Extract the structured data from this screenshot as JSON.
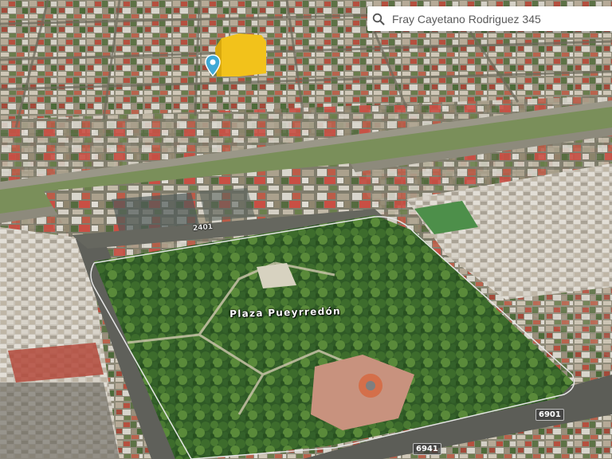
{
  "search": {
    "value": "Fray Cayetano Rodriguez 345",
    "icon": "search-icon"
  },
  "map": {
    "type": "3d-satellite",
    "place_label": "Plaza Pueyrredón",
    "address_numbers": [
      "2401",
      "6901",
      "6941"
    ],
    "pin_color": "#3fa9d6",
    "highlight_color": "#f2c21b"
  }
}
